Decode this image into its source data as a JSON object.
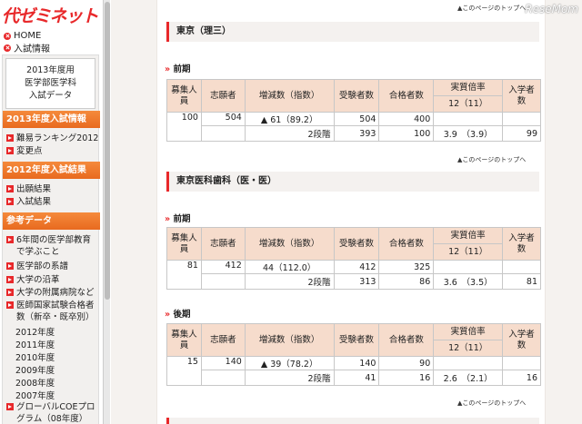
{
  "logo": "代ゼミネット",
  "top_links": [
    "HOME",
    "入試情報"
  ],
  "year_box": [
    "2013年度用",
    "医学部医学科",
    "入試データ"
  ],
  "sections": [
    {
      "title": "2013年度入試情報",
      "items": [
        "難易ランキング2012",
        "変更点"
      ]
    },
    {
      "title": "2012年度入試結果",
      "items": [
        "出願結果",
        "入試結果"
      ]
    },
    {
      "title": "参考データ",
      "items": [
        "6年間の医学部教育で学ぶこと",
        "医学部の系譜",
        "大学の沿革",
        "大学の附属病院など",
        "医師国家試験合格者数（新卒・既卒別）"
      ],
      "years": [
        "2012年度",
        "2011年度",
        "2010年度",
        "2009年度",
        "2008年度",
        "2007年度"
      ],
      "extra": "グローバルCOEプログラム（08年度）"
    }
  ],
  "page_top_link": "▲このページのトップへ",
  "watermark": "ReseMom",
  "headers": {
    "boshu": "募集人員",
    "shigan": "志願者",
    "zougen": "増減数（指数）",
    "juken": "受験者数",
    "goukaku": "合格者数",
    "bairitsu": "実質倍率",
    "bairitsu_sub": "12（11）",
    "nyugaku": "入学者数"
  },
  "universities": [
    {
      "name": "東京（理三）",
      "periods": [
        {
          "label": "前期",
          "boshu": "100",
          "shigan": "504",
          "zougen": "▲ 61（89.2）",
          "juken": "504",
          "goukaku": "400",
          "stage": "2段階",
          "juken2": "393",
          "goukaku2": "100",
          "bairitsu": "3.9　（3.9）",
          "nyugaku": "99"
        }
      ]
    },
    {
      "name": "東京医科歯科（医・医）",
      "periods": [
        {
          "label": "前期",
          "boshu": "81",
          "shigan": "412",
          "zougen": "44（112.0）",
          "juken": "412",
          "goukaku": "325",
          "stage": "2段階",
          "juken2": "313",
          "goukaku2": "86",
          "bairitsu": "3.6　（3.5）",
          "nyugaku": "81"
        },
        {
          "label": "後期",
          "boshu": "15",
          "shigan": "140",
          "zougen": "▲ 39（78.2）",
          "juken": "140",
          "goukaku": "90",
          "stage": "2段階",
          "juken2": "41",
          "goukaku2": "16",
          "bairitsu": "2.6　（2.1）",
          "nyugaku": "16"
        }
      ]
    }
  ]
}
